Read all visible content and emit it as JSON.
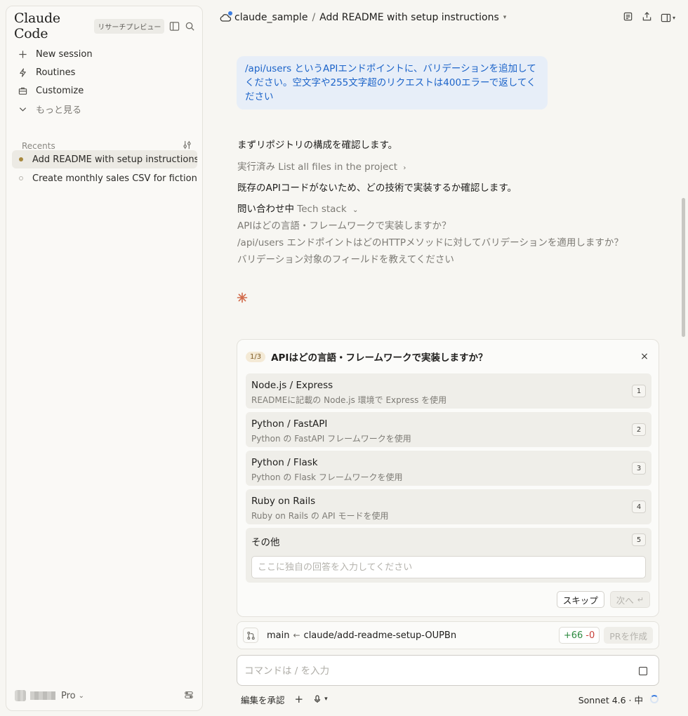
{
  "sidebar": {
    "brand": "Claude Code",
    "badge": "リサーチプレビュー",
    "nav": [
      {
        "label": "New session",
        "icon": "plus-icon"
      },
      {
        "label": "Routines",
        "icon": "bolt-icon"
      },
      {
        "label": "Customize",
        "icon": "briefcase-icon"
      },
      {
        "label": "もっと見る",
        "icon": "chevron-down-icon"
      }
    ],
    "recents_label": "Recents",
    "recents": [
      {
        "title": "Add README with setup instructions",
        "active": true
      },
      {
        "title": "Create monthly sales CSV for fictional",
        "active": false
      }
    ],
    "footer": {
      "plan": "Pro"
    }
  },
  "topbar": {
    "repo": "claude_sample",
    "separator": "/",
    "session_title": "Add README with setup instructions"
  },
  "chat": {
    "user_message": "/api/users というAPIエンドポイントに、バリデーションを追加してください。空文字や255文字超のリクエストは400エラーで返してください",
    "assistant_1": "まずリポジトリの構成を確認します。",
    "tool_done_prefix": "実行済み",
    "tool_done_label": "List all files in the project",
    "assistant_2": "既存のAPIコードがないため、どの技術で実装するか確認します。",
    "asking_prefix": "問い合わせ中",
    "asking_label": "Tech stack",
    "questions": [
      "APIはどの言語・フレームワークで実装しますか？",
      "/api/users エンドポイントはどのHTTPメソッドに対してバリデーションを適用しますか？",
      "バリデーション対象のフィールドを教えてください"
    ]
  },
  "question_card": {
    "step": "1/3",
    "title": "APIはどの言語・フレームワークで実装しますか？",
    "close": "×",
    "options": [
      {
        "title": "Node.js / Express",
        "desc": "READMEに記載の Node.js 環境で Express を使用",
        "key": "1"
      },
      {
        "title": "Python / FastAPI",
        "desc": "Python の FastAPI フレームワークを使用",
        "key": "2"
      },
      {
        "title": "Python / Flask",
        "desc": "Python の Flask フレームワークを使用",
        "key": "3"
      },
      {
        "title": "Ruby on Rails",
        "desc": "Ruby on Rails の API モードを使用",
        "key": "4"
      }
    ],
    "other": {
      "title": "その他",
      "key": "5",
      "placeholder": "ここに独自の回答を入力してください"
    },
    "skip_label": "スキップ",
    "next_label": "次へ",
    "next_hint": "↵"
  },
  "branch": {
    "base": "main",
    "arrow": "←",
    "head": "claude/add-readme-setup-OUPBn",
    "additions": "+66",
    "deletions": "-0",
    "pr_label": "PRを作成"
  },
  "composer": {
    "placeholder": "コマンドは / を入力",
    "accept_label": "編集を承認",
    "plus": "+",
    "model": "Sonnet 4.6 · 中"
  },
  "colors": {
    "accent_blue": "#3c7de0",
    "user_text": "#1b63c9",
    "spark": "#d16a4a",
    "additions": "#2c8a3f",
    "deletions": "#c8413a"
  }
}
